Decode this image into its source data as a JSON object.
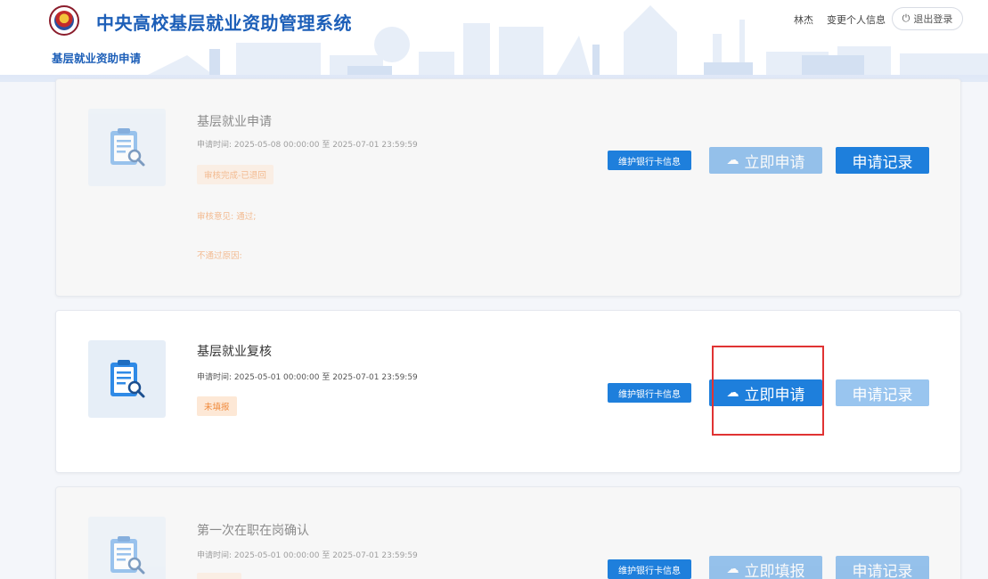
{
  "header": {
    "system_title": "中央高校基层就业资助管理系统",
    "subnav": "基层就业资助申请",
    "user_name": "林杰",
    "edit_profile": "变更个人信息",
    "logout": "退出登录"
  },
  "cards": [
    {
      "title": "基层就业申请",
      "time": "申请时间:  2025-05-08 00:00:00 至 2025-07-01 23:59:59",
      "status": "审核完成-已退回",
      "review_opinion": "审核意见: 通过;",
      "reject_reason": "不通过原因:",
      "bank_button": "维护银行卡信息",
      "apply_button": "立即申请",
      "record_button": "申请记录"
    },
    {
      "title": "基层就业复核",
      "time": "申请时间:  2025-05-01 00:00:00 至 2025-07-01 23:59:59",
      "status": "未填报",
      "bank_button": "维护银行卡信息",
      "apply_button": "立即申请",
      "record_button": "申请记录"
    },
    {
      "title": "第一次在职在岗确认",
      "time": "申请时间:  2025-05-01 00:00:00 至 2025-07-01 23:59:59",
      "bank_button": "维护银行卡信息",
      "apply_button": "立即填报",
      "record_button": "申请记录"
    }
  ],
  "colors": {
    "primary": "#1e7fdc",
    "title_blue": "#1d5fb8",
    "status_orange": "#f08a3c",
    "status_bg": "#fde8d6",
    "highlight_red": "#e03333"
  }
}
